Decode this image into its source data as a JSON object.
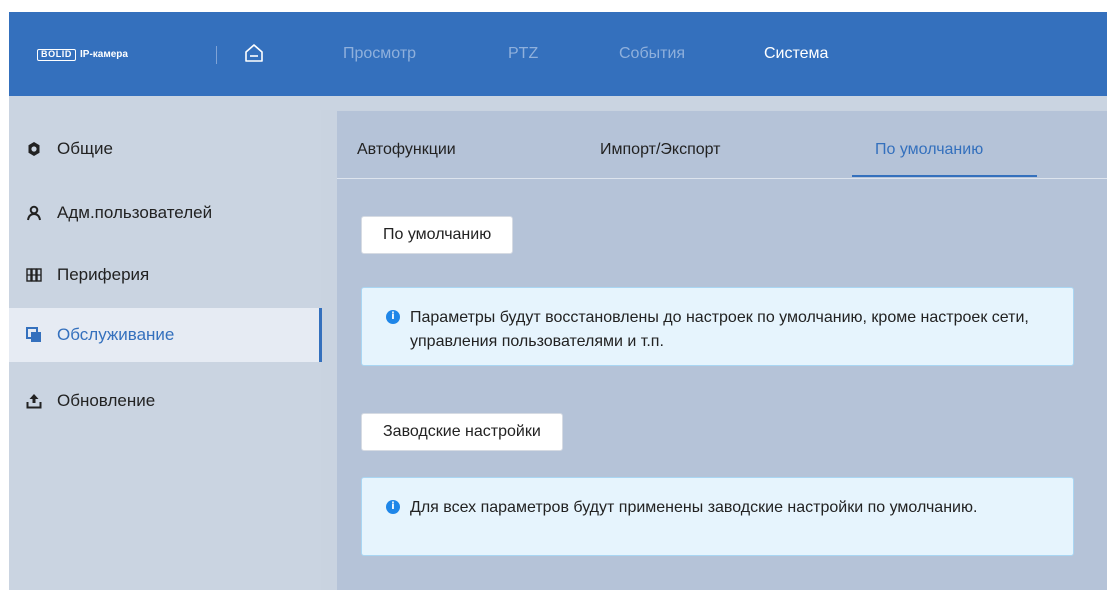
{
  "header": {
    "logo_brand": "BOLID",
    "logo_text": "IP-камера",
    "nav": [
      {
        "label": "Просмотр",
        "active": false
      },
      {
        "label": "PTZ",
        "active": false
      },
      {
        "label": "События",
        "active": false
      },
      {
        "label": "Система",
        "active": true
      }
    ]
  },
  "sidebar": {
    "items": [
      {
        "label": "Общие",
        "icon": "gear-icon"
      },
      {
        "label": "Адм.пользователей",
        "icon": "user-icon"
      },
      {
        "label": "Периферия",
        "icon": "peripheral-icon"
      },
      {
        "label": "Обслуживание",
        "icon": "maintenance-icon",
        "active": true
      },
      {
        "label": "Обновление",
        "icon": "upload-icon"
      }
    ]
  },
  "main": {
    "tabs": [
      {
        "label": "Автофункции"
      },
      {
        "label": "Импорт/Экспорт"
      },
      {
        "label": "По умолчанию",
        "active": true
      }
    ],
    "default_button": "По умолчанию",
    "default_info": "Параметры будут восстановлены до настроек по умолчанию, кроме настроек сети, управления пользователями и т.п.",
    "factory_button": "Заводские настройки",
    "factory_info": "Для всех параметров будут применены заводские настройки по умолчанию."
  },
  "colors": {
    "header": "#3470bd",
    "accent": "#3470bd",
    "sidebar": "#cad4e1",
    "content": "#b5c3d8",
    "info_bg": "#e6f4fd",
    "info_icon": "#1f86e8"
  }
}
